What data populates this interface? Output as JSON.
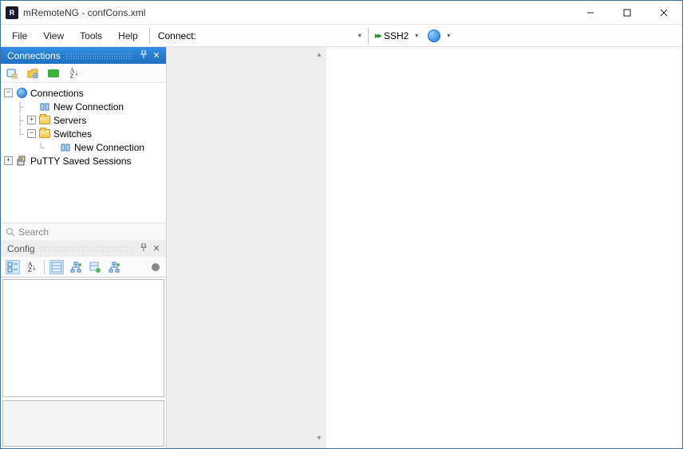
{
  "window": {
    "title": "mRemoteNG - confCons.xml",
    "app_icon_text": "R"
  },
  "menu": {
    "file": "File",
    "view": "View",
    "tools": "Tools",
    "help": "Help",
    "connect_label": "Connect:"
  },
  "quickbar": {
    "protocol": "SSH2"
  },
  "panels": {
    "connections_title": "Connections",
    "config_title": "Config"
  },
  "toolbar": {
    "sort_glyph": "A Z",
    "sort_arrow": "↓"
  },
  "tree": {
    "root": "Connections",
    "new_connection_1": "New Connection",
    "servers": "Servers",
    "switches": "Switches",
    "new_connection_2": "New Connection",
    "putty": "PuTTY Saved Sessions"
  },
  "search": {
    "placeholder": "Search"
  }
}
